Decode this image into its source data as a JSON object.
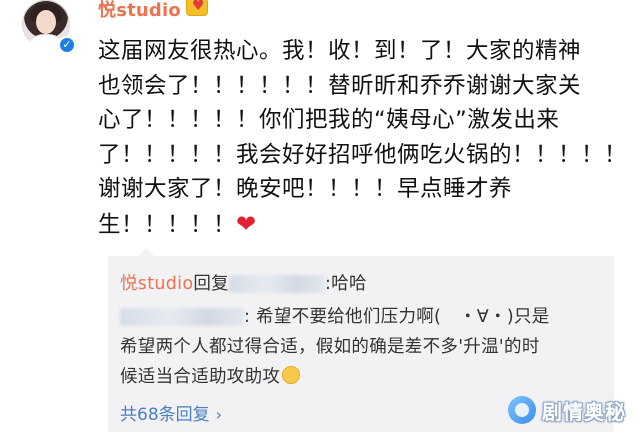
{
  "post": {
    "username": "悦studio",
    "verified_icon": "verified-badge-icon",
    "user_badge_icon": "fan-badge-icon",
    "lines": [
      "这届网友很热心。我！收！到！了！大家的精神",
      "也领会了！！！！！！替昕昕和乔乔谢谢大家关",
      "心了！！！！！你们把我的“姨母心”激发出来",
      "了！！！！！我会好好招呼他俩吃火锅的！！！！！",
      "谢谢大家了！晚安吧！！！！早点睡才养",
      "生！！！！！"
    ],
    "heart": "❤"
  },
  "reply_box": {
    "reply1": {
      "author": "悦studio",
      "verb": "回复",
      "after": ":哈哈"
    },
    "reply2": {
      "line1": ": 希望不要给他们压力啊(　・∀・)只是",
      "line2": "希望两个人都过得合适，假如的确是差不多'升温'的时",
      "line3": "候适当合适助攻助攻"
    },
    "count_label": "共68条回复",
    "chevron": "›"
  },
  "watermark": {
    "text": "剧情奥秘"
  },
  "colors": {
    "username": "#eb7350",
    "link": "#4a7fc1",
    "reply_bg": "#f2f2f5",
    "verified": "#1d7fe2",
    "heart": "#e5202e"
  }
}
